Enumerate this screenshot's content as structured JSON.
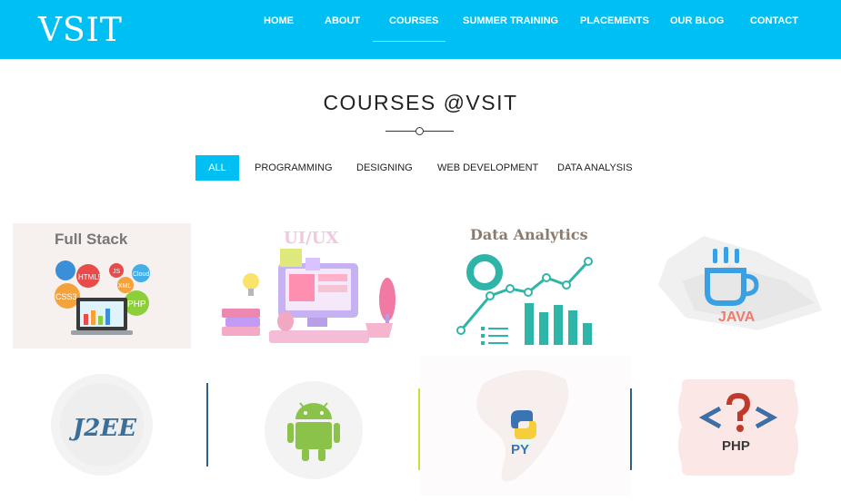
{
  "brand": {
    "logo_text": "VSIT"
  },
  "nav": {
    "items": [
      {
        "label": "HOME"
      },
      {
        "label": "ABOUT"
      },
      {
        "label": "COURSES"
      },
      {
        "label": "SUMMER TRAINING"
      },
      {
        "label": "PLACEMENTS"
      },
      {
        "label": "OUR BLOG"
      },
      {
        "label": "CONTACT"
      }
    ],
    "active": "COURSES"
  },
  "page": {
    "title": "COURSES @VSIT"
  },
  "filters": {
    "items": [
      {
        "label": "ALL"
      },
      {
        "label": "PROGRAMMING"
      },
      {
        "label": "DESIGNING"
      },
      {
        "label": "WEB DEVELOPMENT"
      },
      {
        "label": "DATA ANALYSIS"
      }
    ],
    "active": "ALL"
  },
  "courses": [
    {
      "title": "Full Stack",
      "bubbles": [
        "HTML5",
        "CSS3",
        "JS",
        "XML",
        "PHP",
        "Cloud"
      ],
      "icon": "full-stack-illustration"
    },
    {
      "title": "UI/UX",
      "icon": "ui-ux-illustration"
    },
    {
      "title": "Data Analytics",
      "icon": "data-analytics-illustration"
    },
    {
      "title": "JAVA",
      "icon": "java-coffee-cup-icon"
    },
    {
      "title": "J2EE",
      "icon": "j2ee-logo"
    },
    {
      "title": "",
      "icon": "android-robot-icon"
    },
    {
      "title": "PY",
      "icon": "python-logo"
    },
    {
      "title": "PHP",
      "icon": "php-question-icon"
    }
  ],
  "colors": {
    "nav_bg": "#00bff3",
    "accent": "#00bff3",
    "text_dark": "#222222"
  }
}
